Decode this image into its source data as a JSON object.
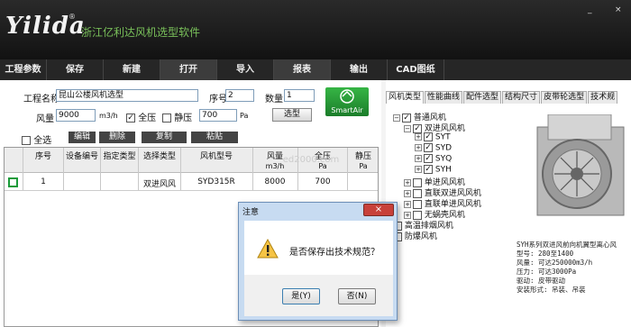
{
  "app": {
    "logo": "Yilida",
    "reg": "®",
    "title": "浙江亿利达风机选型软件",
    "minimize": "_",
    "close": "×"
  },
  "menu": [
    "工程参数",
    "保存",
    "新建",
    "打开",
    "导入",
    "报表",
    "输出",
    "CAD图纸"
  ],
  "form": {
    "project_label": "工程名称",
    "project_value": "昆山公楼风机选型",
    "seq_label": "序号",
    "seq_value": "2",
    "qty_label": "数量",
    "qty_value": "1",
    "airflow_label": "风量",
    "airflow_value": "9000",
    "airflow_unit": "m3/h",
    "total_pressure_label": "全压",
    "static_pressure_label": "静压",
    "pressure_value": "700",
    "pressure_unit": "Pa",
    "select_button": "选型",
    "smartair": "SmartAir",
    "select_all": "全选",
    "edit": "编辑",
    "delete": "删除",
    "copy": "复制",
    "paste": "粘贴"
  },
  "table": {
    "headers": [
      "序号",
      "设备编号",
      "指定类型",
      "选择类型",
      "风机型号",
      "风量",
      "全压",
      "静压"
    ],
    "units": {
      "airflow": "m3/h",
      "pressure": "Pa",
      "static": "Pa"
    },
    "rows": [
      {
        "seq": "1",
        "device": "",
        "type": "",
        "selected": "双进风风",
        "model": "SYD315R",
        "airflow": "8000",
        "pressure": "700"
      }
    ]
  },
  "tabs": [
    "风机类型",
    "性能曲线",
    "配件选型",
    "结构尺寸",
    "皮带轮选型",
    "技术规"
  ],
  "tree": {
    "root": "普通风机",
    "group": "双进风风机",
    "leaves": [
      "SYT",
      "SYD",
      "SYQ",
      "SYH"
    ],
    "others": [
      "单进风风机",
      "直联双进风风机",
      "直联单进风风机",
      "无蜗壳风机"
    ],
    "roots": [
      "高温排烟风机",
      "防爆风机"
    ]
  },
  "description": [
    "SYH系列双进风前向机翼型离心风",
    "型号: 280至1400",
    "风量: 可达250000m3/h",
    "压力: 可达3000Pa",
    "驱动: 皮带驱动",
    "安装形式: 吊装、吊装"
  ],
  "watermark": "ed2000.com",
  "dialog": {
    "title": "注意",
    "message": "是否保存出技术规范？",
    "yes": "是(Y)",
    "no": "否(N)",
    "close": "×"
  }
}
